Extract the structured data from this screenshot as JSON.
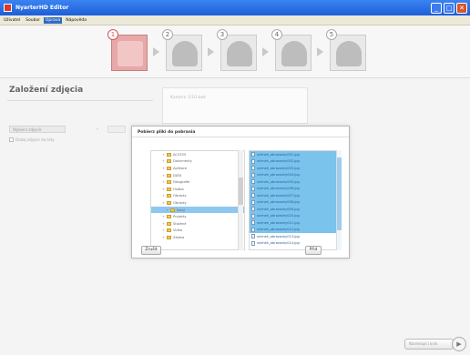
{
  "window": {
    "title": "NyarterHD Editor"
  },
  "menu": {
    "items": [
      "Uživatel",
      "Soubor",
      "Úprava",
      "Nápověda"
    ],
    "active_index": 2
  },
  "steps": [
    {
      "number": "1",
      "current": true
    },
    {
      "number": "2",
      "current": false
    },
    {
      "number": "3",
      "current": false
    },
    {
      "number": "4",
      "current": false
    },
    {
      "number": "5",
      "current": false
    }
  ],
  "page": {
    "section_title": "Založení zdjęcia",
    "preview_label": "Kamera 1/10 bwt",
    "select_button": "Wybierz zdjęcie",
    "checkbox_label": "Dodaj zdjęcie do listy"
  },
  "dialog": {
    "title": "Pobierz pliki do pobrania",
    "tree": [
      {
        "label": "ACCESS",
        "selected": false
      },
      {
        "label": "Dokumenty",
        "selected": false
      },
      {
        "label": "Aplikace",
        "selected": false
      },
      {
        "label": "DATA",
        "selected": false
      },
      {
        "label": "Fotografie",
        "selected": false
      },
      {
        "label": "Hudba",
        "selected": false
      },
      {
        "label": "Obrázky",
        "selected": false
      },
      {
        "label": "Obrázky",
        "selected": false
      },
      {
        "label": "Nový",
        "selected": true
      },
      {
        "label": "Projekty",
        "selected": false
      },
      {
        "label": "Stažené",
        "selected": false
      },
      {
        "label": "Videa",
        "selected": false
      },
      {
        "label": "Záloha",
        "selected": false
      }
    ],
    "files": [
      {
        "label": "snímek_obrazovky001.jpg",
        "selected": true
      },
      {
        "label": "snímek_obrazovky002.jpg",
        "selected": true
      },
      {
        "label": "snímek_obrazovky003.jpg",
        "selected": true
      },
      {
        "label": "snímek_obrazovky004.jpg",
        "selected": true
      },
      {
        "label": "snímek_obrazovky005.jpg",
        "selected": true
      },
      {
        "label": "snímek_obrazovky006.jpg",
        "selected": true
      },
      {
        "label": "snímek_obrazovky007.jpg",
        "selected": true
      },
      {
        "label": "snímek_obrazovky008.jpg",
        "selected": true
      },
      {
        "label": "snímek_obrazovky009.jpg",
        "selected": true
      },
      {
        "label": "snímek_obrazovky010.jpg",
        "selected": true
      },
      {
        "label": "snímek_obrazovky011.jpg",
        "selected": true
      },
      {
        "label": "snímek_obrazovky012.jpg",
        "selected": true
      },
      {
        "label": "snímek_obrazovky013.jpg",
        "selected": false
      },
      {
        "label": "snímek_obrazovky014.jpg",
        "selected": false
      }
    ],
    "cancel_label": "Zrušit",
    "ok_label": "Přid"
  },
  "footer": {
    "next_label": "Následující krok"
  },
  "colors": {
    "accent": "#316ac5",
    "selection": "#79c3ec",
    "title_bar": "#1c5fd8",
    "current_step": "#e7a8a8"
  }
}
